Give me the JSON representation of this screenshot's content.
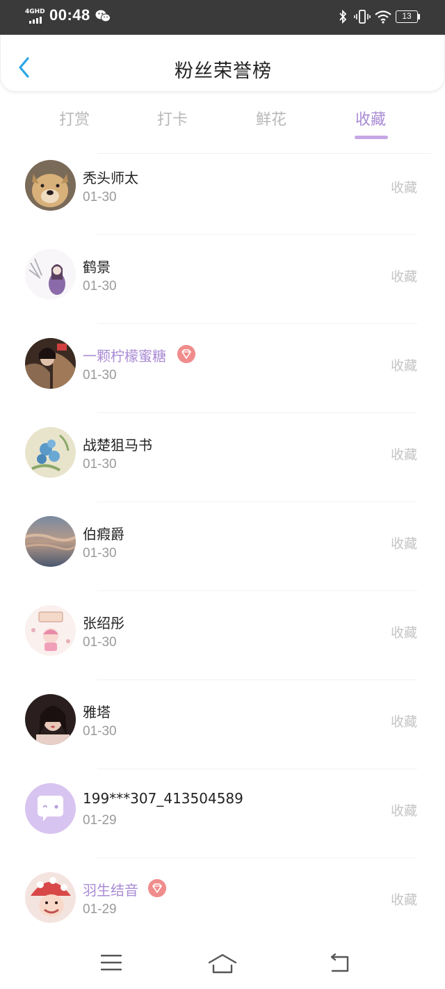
{
  "status_bar": {
    "network": "4GHD",
    "time": "00:48",
    "battery": "13"
  },
  "header": {
    "title": "粉丝荣誉榜"
  },
  "tabs": [
    {
      "label": "打赏"
    },
    {
      "label": "打卡"
    },
    {
      "label": "鲜花"
    },
    {
      "label": "收藏"
    }
  ],
  "active_tab": "收藏",
  "accent_color": "#a98bd4",
  "list": [
    {
      "name": "秃头师太",
      "date": "01-30",
      "action": "收藏",
      "vip": false,
      "avatar": "dog-photo"
    },
    {
      "name": "鹤景",
      "date": "01-30",
      "action": "收藏",
      "vip": false,
      "avatar": "anime-girl-illustration"
    },
    {
      "name": "一颗柠檬蜜糖",
      "date": "01-30",
      "action": "收藏",
      "vip": true,
      "avatar": "selfie-photo"
    },
    {
      "name": "战楚狙马书",
      "date": "01-30",
      "action": "收藏",
      "vip": false,
      "avatar": "flower-painting"
    },
    {
      "name": "伯瘕爵",
      "date": "01-30",
      "action": "收藏",
      "vip": false,
      "avatar": "sunset-clouds"
    },
    {
      "name": "张绍彤",
      "date": "01-30",
      "action": "收藏",
      "vip": false,
      "avatar": "cartoon-sticker"
    },
    {
      "name": "雅塔",
      "date": "01-30",
      "action": "收藏",
      "vip": false,
      "avatar": "portrait-photo"
    },
    {
      "name": "199***307_413504589",
      "date": "01-29",
      "action": "收藏",
      "vip": false,
      "avatar": "default-chat-avatar"
    },
    {
      "name": "羽生结音",
      "date": "01-29",
      "action": "收藏",
      "vip": true,
      "avatar": "beanie-girl-photo"
    }
  ]
}
